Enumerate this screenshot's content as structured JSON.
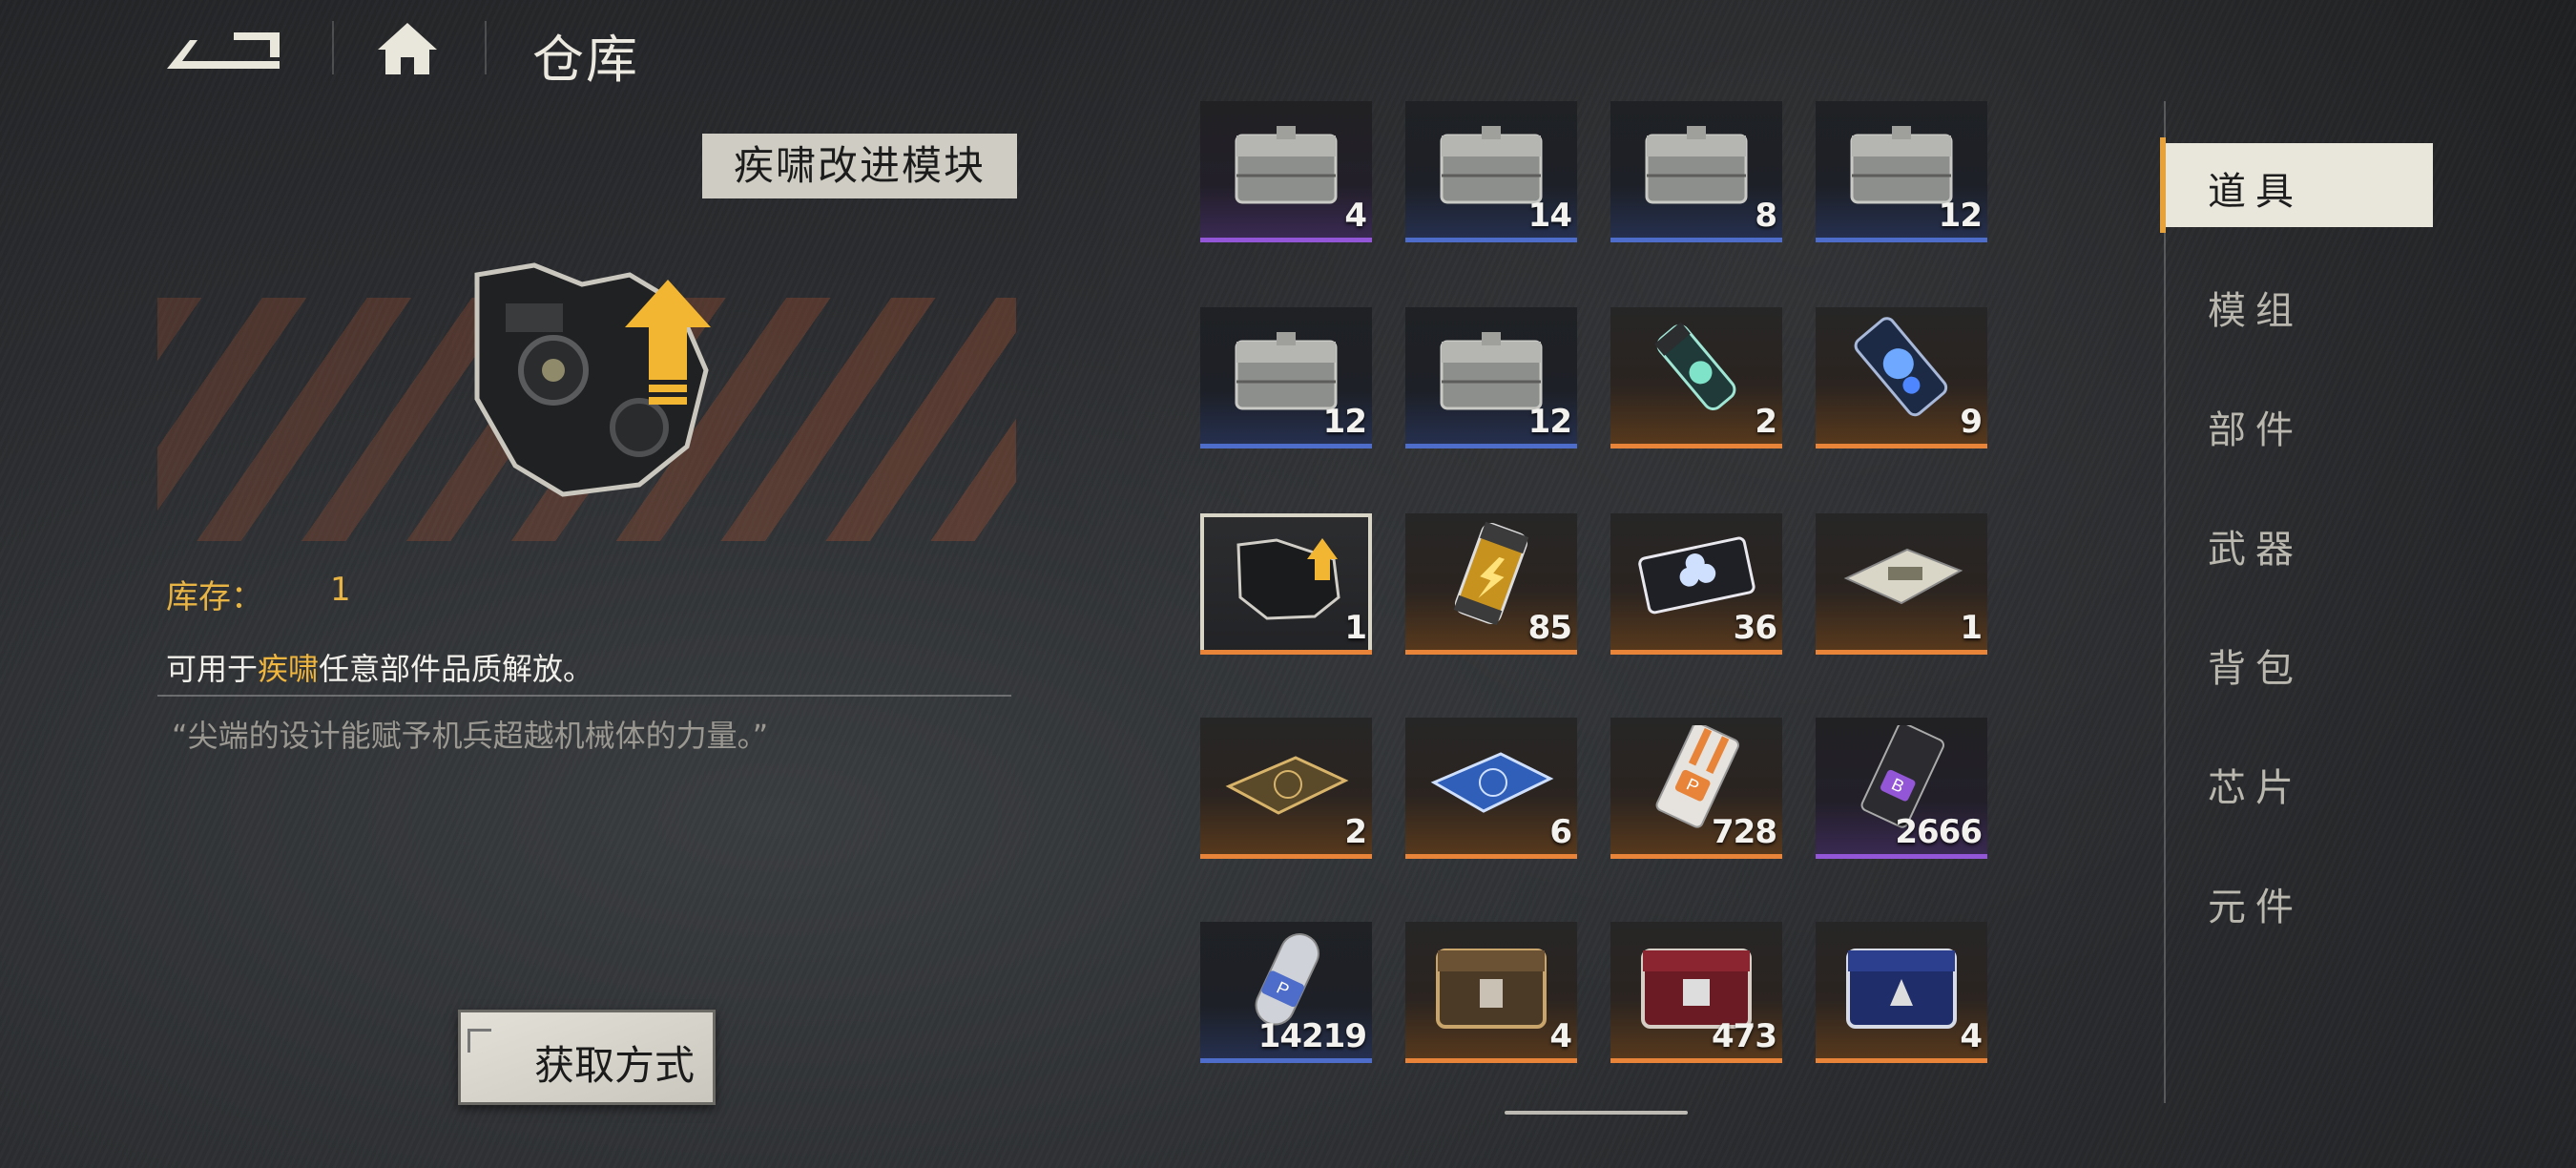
{
  "header": {
    "title": "仓库"
  },
  "detail": {
    "item_name": "疾啸改进模块",
    "stock_label": "库存：",
    "stock_value": "1",
    "desc_prefix": "可用于",
    "desc_highlight": "疾啸",
    "desc_suffix": "任意部件品质解放。",
    "flavor": "“尖端的设计能赋予机兵超越机械体的力量。”",
    "obtain_button": "获取方式"
  },
  "grid": {
    "items": [
      {
        "icon": "supply-crate-icon",
        "count": "4",
        "quality": "purple"
      },
      {
        "icon": "supply-crate-icon",
        "count": "14",
        "quality": "blue"
      },
      {
        "icon": "supply-crate-icon",
        "count": "8",
        "quality": "blue"
      },
      {
        "icon": "supply-crate-icon",
        "count": "12",
        "quality": "blue"
      },
      {
        "icon": "supply-crate-icon",
        "count": "12",
        "quality": "blue"
      },
      {
        "icon": "supply-crate-icon",
        "count": "12",
        "quality": "blue"
      },
      {
        "icon": "green-capsule-icon",
        "count": "2",
        "quality": "orange"
      },
      {
        "icon": "blue-capsule-icon",
        "count": "9",
        "quality": "orange"
      },
      {
        "icon": "upgrade-module-icon",
        "count": "1",
        "quality": "orange",
        "selected": true
      },
      {
        "icon": "energy-cell-icon",
        "count": "85",
        "quality": "orange"
      },
      {
        "icon": "tablet-device-icon",
        "count": "36",
        "quality": "orange"
      },
      {
        "icon": "metal-plate-icon",
        "count": "1",
        "quality": "orange"
      },
      {
        "icon": "gold-blueprint-icon",
        "count": "2",
        "quality": "orange"
      },
      {
        "icon": "blue-blueprint-icon",
        "count": "6",
        "quality": "orange"
      },
      {
        "icon": "chip-p-orange-icon",
        "count": "728",
        "quality": "orange"
      },
      {
        "icon": "chip-b-purple-icon",
        "count": "2666",
        "quality": "purple"
      },
      {
        "icon": "chip-p-blue-icon",
        "count": "14219",
        "quality": "blue"
      },
      {
        "icon": "bronze-chest-icon",
        "count": "4",
        "quality": "orange"
      },
      {
        "icon": "red-chest-icon",
        "count": "473",
        "quality": "orange"
      },
      {
        "icon": "blue-chest-icon",
        "count": "4",
        "quality": "orange"
      }
    ]
  },
  "tabs": [
    {
      "label": "道具",
      "active": true
    },
    {
      "label": "模组"
    },
    {
      "label": "部件"
    },
    {
      "label": "武器"
    },
    {
      "label": "背包"
    },
    {
      "label": "芯片"
    },
    {
      "label": "元件"
    }
  ],
  "colors": {
    "accent_orange": "#e8843a",
    "accent_blue": "#4e6cc9",
    "accent_purple": "#9256d6",
    "highlight_gold": "#f0b63e"
  }
}
